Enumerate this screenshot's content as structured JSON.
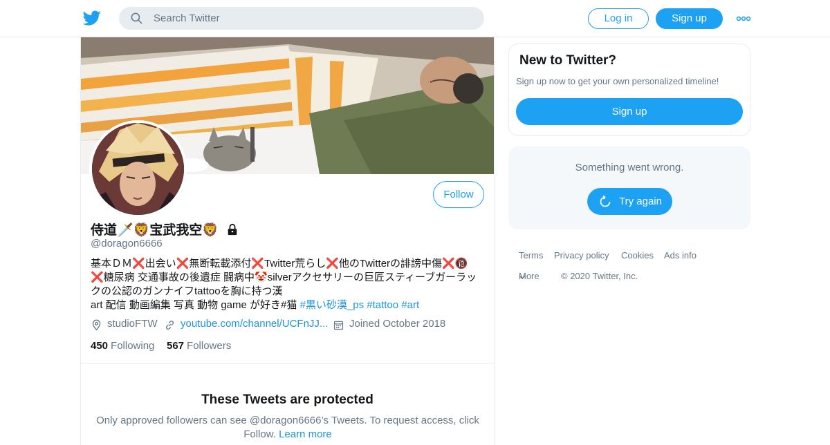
{
  "header": {
    "search_placeholder": "Search Twitter",
    "login_label": "Log in",
    "signup_label": "Sign up",
    "brand_color": "#1da1f2"
  },
  "profile": {
    "display_name": "侍道🗡️🦁宝武我空🦁",
    "handle": "@doragon6666",
    "follow_label": "Follow",
    "bio_lines": [
      "基本ＤＭ❌出会い❌無断転載添付❌Twitter荒らし❌他のTwitterの誹謗中傷❌🔞",
      "❌糖尿病 交通事故の後遺症 闘病中🤡silverアクセサリーの巨匠スティーブガーラッ",
      "クの公認のガンナイフtattooを胸に持つ漢",
      "art 配信 動画編集 写真 動物 game が好き#猫 "
    ],
    "bio_hashtags": [
      "#黒い砂漠_ps",
      "#tattoo",
      "#art"
    ],
    "location": "studioFTW",
    "website": "youtube.com/channel/UCFnJJ...",
    "joined": "Joined October 2018",
    "following_count": "450",
    "following_label": "Following",
    "followers_count": "567",
    "followers_label": "Followers"
  },
  "protected": {
    "title": "These Tweets are protected",
    "body": "Only approved followers can see @doragon6666’s Tweets. To request access, click Follow.",
    "learn_more": "Learn more"
  },
  "sidebar": {
    "signup_card": {
      "title": "New to Twitter?",
      "subtitle": "Sign up now to get your own personalized timeline!",
      "button_label": "Sign up"
    },
    "error_card": {
      "message": "Something went wrong.",
      "retry_label": "Try again"
    },
    "footer": {
      "terms": "Terms",
      "privacy": "Privacy policy",
      "cookies": "Cookies",
      "ads_info": "Ads info",
      "more": "More",
      "copyright": "© 2020 Twitter, Inc."
    }
  }
}
